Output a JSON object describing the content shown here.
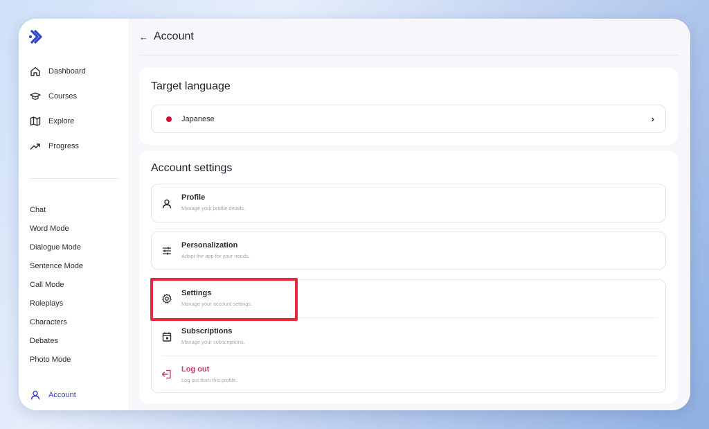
{
  "sidebar": {
    "logo": "app-logo",
    "nav": [
      {
        "label": "Dashboard",
        "icon": "home-icon"
      },
      {
        "label": "Courses",
        "icon": "graduation-cap-icon"
      },
      {
        "label": "Explore",
        "icon": "map-icon"
      },
      {
        "label": "Progress",
        "icon": "trending-up-icon"
      }
    ],
    "modes": [
      "Chat",
      "Word Mode",
      "Dialogue Mode",
      "Sentence Mode",
      "Call Mode",
      "Roleplays",
      "Characters",
      "Debates",
      "Photo Mode"
    ],
    "account": {
      "label": "Account",
      "icon": "user-icon"
    }
  },
  "header": {
    "back_icon": "←",
    "title": "Account"
  },
  "target_language": {
    "title": "Target language",
    "language": "Japanese",
    "flag_color": "#d40d2a",
    "chevron": "›"
  },
  "account_settings": {
    "title": "Account settings",
    "profile": {
      "title": "Profile",
      "subtitle": "Manage your profile details.",
      "icon": "user-icon"
    },
    "personalization": {
      "title": "Personalization",
      "subtitle": "Adapt the app for your needs.",
      "icon": "sliders-icon"
    },
    "settings": {
      "title": "Settings",
      "subtitle": "Manage your account settings.",
      "icon": "gear-icon"
    },
    "subscriptions": {
      "title": "Subscriptions",
      "subtitle": "Manage your subscriptions.",
      "icon": "calendar-icon"
    },
    "logout": {
      "title": "Log out",
      "subtitle": "Log out from this profile.",
      "icon": "logout-icon"
    }
  },
  "colors": {
    "accent": "#3343c9",
    "highlight": "#e8293c",
    "logout": "#d13a6f"
  }
}
